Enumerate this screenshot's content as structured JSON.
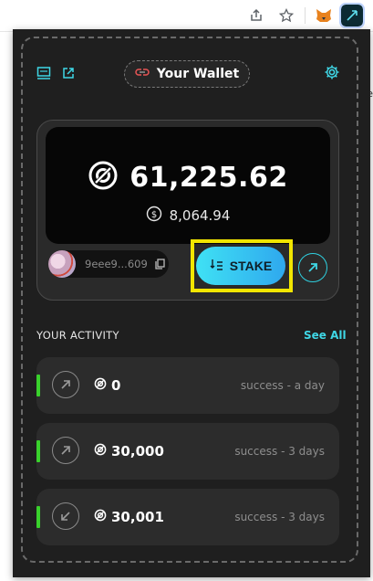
{
  "browser": {
    "right_peek_text": "ge"
  },
  "header": {
    "wallet_title": "Your Wallet"
  },
  "balance": {
    "token_amount": "61,225.62",
    "usd_amount": "8,064.94",
    "address": "9eee9...609"
  },
  "actions": {
    "stake_label": "STAKE"
  },
  "activity": {
    "title": "YOUR ACTIVITY",
    "see_all": "See All",
    "items": [
      {
        "amount": "0",
        "status": "success - a day",
        "direction": "sent"
      },
      {
        "amount": "30,000",
        "status": "success - 3 days",
        "direction": "sent"
      },
      {
        "amount": "30,001",
        "status": "success - 3 days",
        "direction": "received"
      }
    ]
  },
  "colors": {
    "accent": "#3fd7e6",
    "success_bar": "#39d12c",
    "highlight": "#f2e600"
  }
}
